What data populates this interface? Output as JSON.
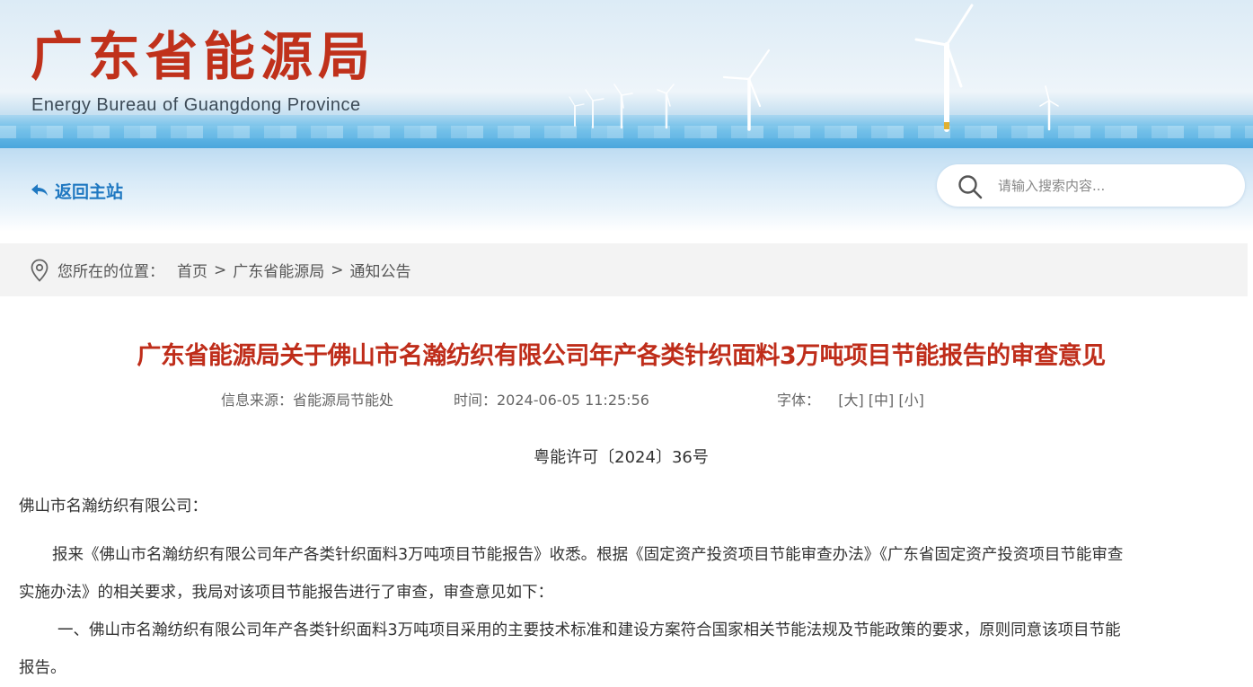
{
  "header": {
    "logo_cn": "广东省能源局",
    "logo_en": "Energy Bureau of Guangdong Province",
    "banner_image": "offshore-wind-turbines"
  },
  "nav": {
    "back_label": "返回主站",
    "back_icon": "return-arrow-icon",
    "search_placeholder": "请输入搜索内容...",
    "search_icon": "search-icon"
  },
  "breadcrumb": {
    "icon": "location-pin-icon",
    "prefix": "您所在的位置：",
    "items": [
      "首页",
      "广东省能源局",
      "通知公告"
    ],
    "separator": ">"
  },
  "article": {
    "title": "广东省能源局关于佛山市名瀚纺织有限公司年产各类针织面料3万吨项目节能报告的审查意见",
    "source": "信息来源：省能源局节能处",
    "time": "时间：2024-06-05 11:25:56",
    "font_label": "字体：",
    "font_sizes": [
      "[大]",
      "[中]",
      "[小]"
    ],
    "doc_number": "粤能许可〔2024〕36号",
    "salutation": "佛山市名瀚纺织有限公司：",
    "para1_line1": "报来《佛山市名瀚纺织有限公司年产各类针织面料3万吨项目节能报告》收悉。根据《固定资产投资项目节能审查办法》《广东省固定资产投资项目节能审查",
    "para1_line2": "实施办法》的相关要求，我局对该项目节能报告进行了审查，审查意见如下：",
    "para2_line1": "一、佛山市名瀚纺织有限公司年产各类针织面料3万吨项目采用的主要技术标准和建设方案符合国家相关节能法规及节能政策的要求，原则同意该项目节能",
    "para2_line2": "报告。"
  },
  "colors": {
    "title_red": "#bf2d1a",
    "logo_red": "#c0311b",
    "link_blue": "#1f78c1",
    "breadcrumb_bg": "#f3f3f3"
  }
}
